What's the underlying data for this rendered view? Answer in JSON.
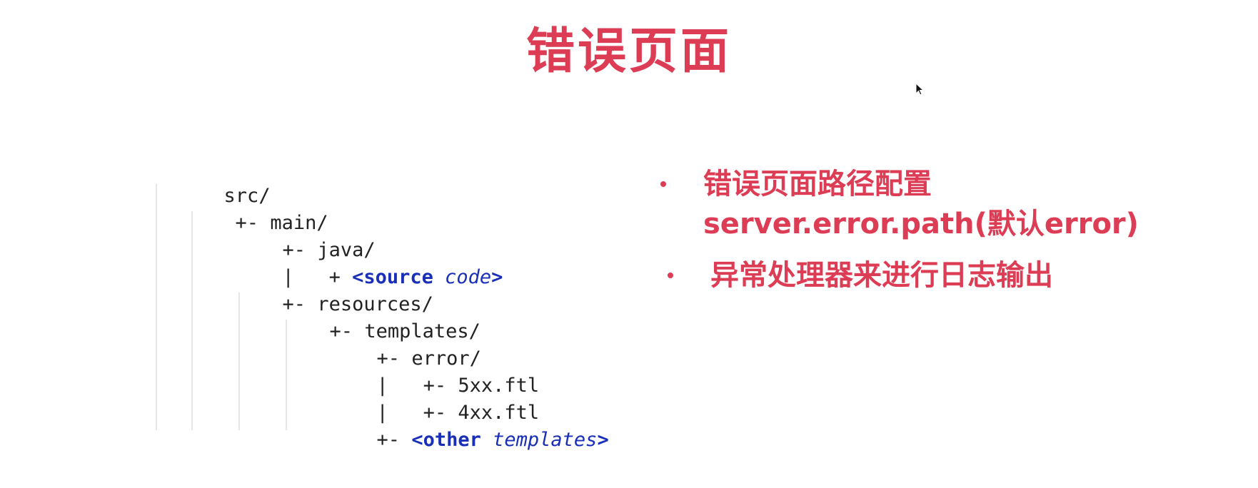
{
  "slide": {
    "title": "错误页面",
    "tree": {
      "lines": [
        {
          "prefix": "src/"
        },
        {
          "prefix": "+- main/"
        },
        {
          "prefix": "+- java/"
        },
        {
          "prefix": "|   + ",
          "kw": "<source",
          "it": " code",
          "tail": ">"
        },
        {
          "prefix": "+- resources/"
        },
        {
          "prefix": "+- templates/"
        },
        {
          "prefix": "+- error/"
        },
        {
          "prefix": "|   +- 5xx.ftl"
        },
        {
          "prefix": "|   +- 4xx.ftl"
        },
        {
          "prefix": "+- ",
          "kw": "<other",
          "it": " templates",
          "tail": ">"
        }
      ]
    },
    "bullets": [
      {
        "line1": "错误页面路径配置",
        "line2": "server.error.path(默认error)"
      },
      {
        "line1": "异常处理器来进行日志输出"
      }
    ],
    "colors": {
      "accent": "#dd3c55",
      "code_keyword": "#1a2fb8",
      "text": "#222222"
    },
    "icons": {
      "cursor": "mouse-pointer-icon"
    }
  }
}
